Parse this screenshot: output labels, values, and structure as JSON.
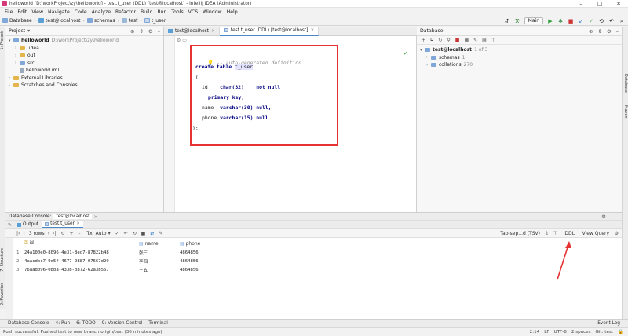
{
  "window": {
    "title": "helloworld [D:\\workProject\\zy\\helloworld] - test.t_user (DDL) [test@localhost] - IntelliJ IDEA (Administrator)",
    "controls": [
      "–",
      "□",
      "✕"
    ]
  },
  "menu": [
    "File",
    "Edit",
    "View",
    "Navigate",
    "Code",
    "Analyze",
    "Refactor",
    "Build",
    "Run",
    "Tools",
    "VCS",
    "Window",
    "Help"
  ],
  "breadcrumbs": [
    "Database",
    "test@localhost",
    "schemas",
    "test",
    "t_user"
  ],
  "toolbar": {
    "run_config": "Main"
  },
  "project": {
    "header": "Project",
    "tree": [
      {
        "label": "helloworld",
        "note": "D:\\workProject\\zy\\helloworld",
        "depth": 0,
        "kind": "folder-blue",
        "expanded": true
      },
      {
        "label": ".idea",
        "depth": 1,
        "kind": "folder",
        "expanded": false
      },
      {
        "label": "out",
        "depth": 1,
        "kind": "folder",
        "expanded": false
      },
      {
        "label": "src",
        "depth": 1,
        "kind": "folder-blue",
        "expanded": false
      },
      {
        "label": "helloworld.iml",
        "depth": 1,
        "kind": "file",
        "expanded": null
      },
      {
        "label": "External Libraries",
        "depth": 0,
        "kind": "folder",
        "expanded": false
      },
      {
        "label": "Scratches and Consoles",
        "depth": 0,
        "kind": "folder",
        "expanded": false
      }
    ]
  },
  "editor": {
    "tabs": [
      {
        "label": "test@localhost",
        "active": false
      },
      {
        "label": "test.t_user (DDL) [test@localhost]",
        "active": true
      }
    ],
    "code": {
      "comment": "-- auto-generated definition",
      "kw_create": "create table",
      "table_name": "t_user",
      "open": "(",
      "close": ");",
      "col_id": "id",
      "col_id_type": "char(32)",
      "col_id_mod": "not null",
      "col_id_pk": "primary key,",
      "col_name": "name",
      "col_name_type": "varchar(30)",
      "col_name_mod": "null,",
      "col_phone": "phone",
      "col_phone_type": "varchar(15)",
      "col_phone_mod": "null"
    }
  },
  "database": {
    "header": "Database",
    "tree": [
      {
        "label": "test@localhost",
        "note": "1 of 3",
        "depth": 0
      },
      {
        "label": "schemas",
        "note": "1",
        "depth": 1
      },
      {
        "label": "collations",
        "note": "270",
        "depth": 1
      }
    ]
  },
  "console": {
    "header": "Database Console:",
    "header_tab": "test@localhost",
    "tabs": [
      {
        "label": "Output",
        "active": false
      },
      {
        "label": "test.t_user",
        "active": true
      }
    ],
    "rows_label": "3 rows",
    "tx_label": "Tx: Auto",
    "right_label": "Tab-sep...d (TSV)",
    "ddl_label": "DDL",
    "view_query": "View Query"
  },
  "results": {
    "columns": [
      "id",
      "name",
      "phone"
    ],
    "rows": [
      [
        "1",
        "24a100e0-8096-4e31-8ed7-87822b48",
        "张三",
        "4864856"
      ],
      [
        "2",
        "4aacdbc7-9d5f-4677-9887-07667d29",
        "李四",
        "4864856"
      ],
      [
        "3",
        "76aad096-08ba-433b-b872-62a3b567",
        "王五",
        "4864856"
      ]
    ]
  },
  "tool_windows": [
    "Database Console",
    "4: Run",
    "6: TODO",
    "9: Version Control",
    "Terminal"
  ],
  "tool_windows_right": "Event Log",
  "status": {
    "message": "Push successful: Pushed test to new branch origin/test (36 minutes ago)",
    "right": [
      "2:14",
      "LF",
      "UTF-8",
      "2 spaces",
      "Git: test"
    ]
  }
}
